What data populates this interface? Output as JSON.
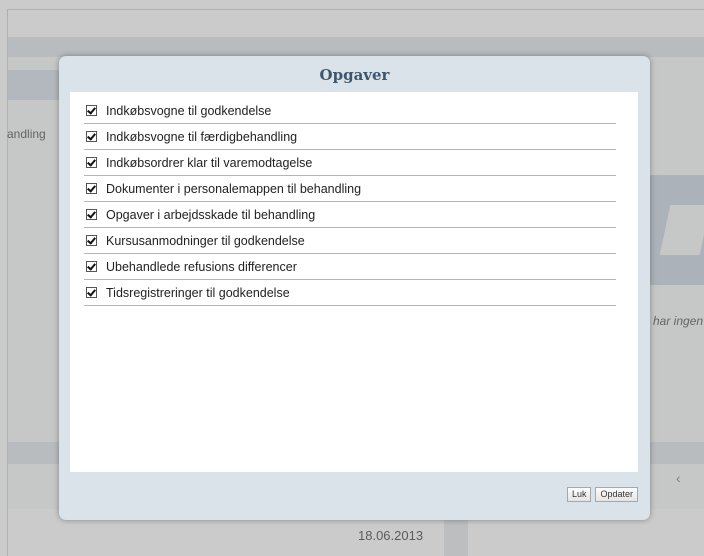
{
  "background": {
    "left_fragment_text": "andling",
    "right_fragment_text": "har ingen",
    "date_text": "18.06.2013",
    "chevron_icon": "chevron-left-icon"
  },
  "dialog": {
    "title": "Opgaver",
    "items": [
      {
        "label": "Indkøbsvogne til godkendelse",
        "checked": true
      },
      {
        "label": "Indkøbsvogne til færdigbehandling",
        "checked": true
      },
      {
        "label": "Indkøbsordrer klar til varemodtagelse",
        "checked": true
      },
      {
        "label": "Dokumenter i personalemappen til behandling",
        "checked": true
      },
      {
        "label": "Opgaver i arbejdsskade til behandling",
        "checked": true
      },
      {
        "label": "Kursusanmodninger til godkendelse",
        "checked": true
      },
      {
        "label": "Ubehandlede refusions differencer",
        "checked": true
      },
      {
        "label": "Tidsregistreringer til godkendelse",
        "checked": true
      }
    ],
    "buttons": {
      "close_label": "Luk",
      "update_label": "Opdater"
    }
  },
  "colors": {
    "dialog_background": "#dbe3ea",
    "title_color": "#3d566e",
    "overlay": "rgba(140,140,140,0.45)"
  }
}
